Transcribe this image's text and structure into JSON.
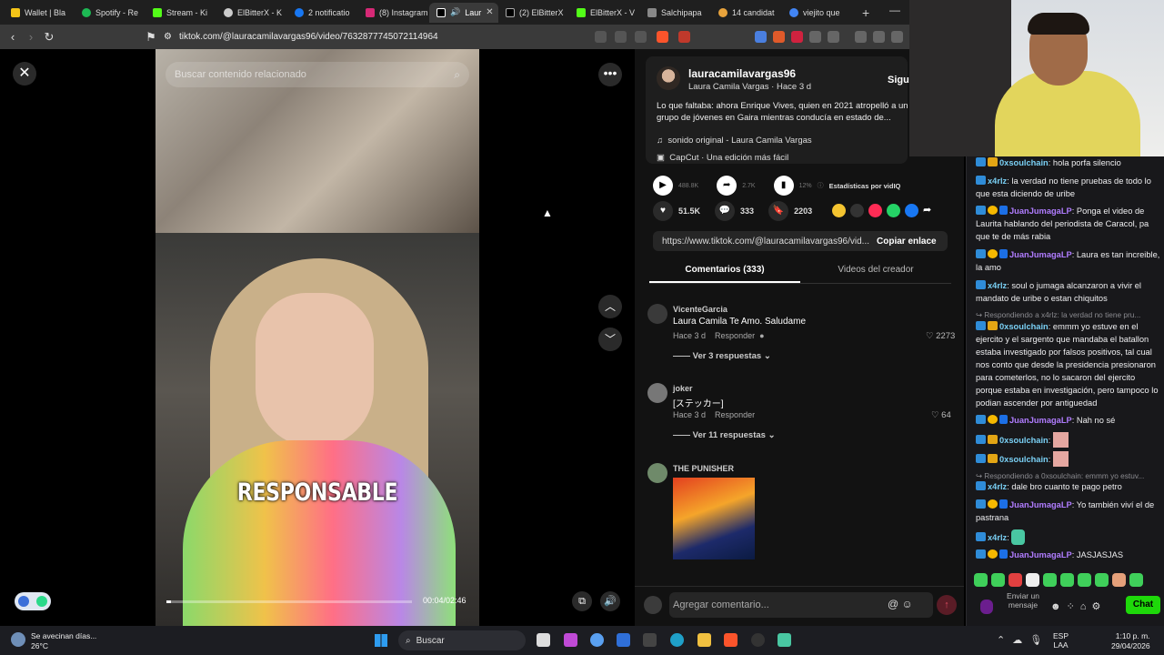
{
  "browser": {
    "tabs": [
      {
        "label": "Wallet | Bla",
        "color": "#f5c518"
      },
      {
        "label": "Spotify - Re",
        "color": "#1db954"
      },
      {
        "label": "Stream - Ki",
        "color": "#53fc18"
      },
      {
        "label": "ElBitterX - K",
        "color": "#cccccc"
      },
      {
        "label": "2 notificatio",
        "color": "#1877f2"
      },
      {
        "label": "(8) Instagram",
        "color": "#d62976"
      },
      {
        "label": "Laur",
        "color": "#ffffff",
        "active": true
      },
      {
        "label": "(2) ElBitterX",
        "color": "#000000"
      },
      {
        "label": "ElBitterX - V",
        "color": "#53fc18"
      },
      {
        "label": "Salchipapa",
        "color": "#888888"
      },
      {
        "label": "14 candidat",
        "color": "#e8a33c"
      },
      {
        "label": "viejito que",
        "color": "#4285f4"
      }
    ],
    "new_tab": "+",
    "minimize": "—",
    "url": "tiktok.com/@lauracamilavargas96/video/7632877745072114964"
  },
  "video": {
    "search_placeholder": "Buscar contenido relacionado",
    "caption": "RESPONSABLE",
    "time": "00:04/02:46",
    "progress_fraction": 0.02
  },
  "post": {
    "username": "lauracamilavargas96",
    "display_name": "Laura Camila Vargas",
    "age": "Hace 3 d",
    "follow": "Sigui",
    "description": "Lo que faltaba: ahora Enrique Vives, quien en 2021 atropelló a un grupo de jóvenes en Gaira mientras conducía en estado de...",
    "sound": "sonido original - Laura Camila Vargas",
    "capcut": "CapCut · Una edición más fácil",
    "views": "488.8K",
    "shares_stat": "2.7K",
    "percent": "12%",
    "stats_label": "Estadísticas por vidIQ",
    "likes": "51.5K",
    "comments": "333",
    "saves": "2203",
    "link": "https://www.tiktok.com/@lauracamilavargas96/vid...",
    "copy_link": "Copiar enlace",
    "tab_comments": "Comentarios (333)",
    "tab_videos": "Videos del creador"
  },
  "comments": [
    {
      "user": "VicenteGarcia",
      "text": "Laura Camila Te Amo. Saludame",
      "age": "Hace 3 d",
      "reply": "Responder",
      "likes": "2273",
      "replies": "Ver 3 respuestas"
    },
    {
      "user": "joker",
      "text": "[ステッカー]",
      "age": "Hace 3 d",
      "reply": "Responder",
      "likes": "64",
      "replies": "Ver 11 respuestas"
    },
    {
      "user": "THE PUNISHER"
    }
  ],
  "add_comment_placeholder": "Agregar comentario...",
  "chat": {
    "messages": [
      {
        "user": "0xsoulchain",
        "text": "hola porfa silencio"
      },
      {
        "user": "x4rlz",
        "text": "la verdad no tiene pruebas de todo lo que esta diciendo de uribe"
      },
      {
        "user": "JuanJumagaLP",
        "text": "Ponga el video de Laurita hablando del periodista de Caracol, pa que te de más rabia"
      },
      {
        "user": "JuanJumagaLP",
        "text": "Laura es tan increible, la amo"
      },
      {
        "user": "x4rlz",
        "text": "soul o jumaga alcanzaron a vivir el mandato de uribe o estan chiquitos"
      },
      {
        "reply_note": "Respondiendo a x4rlz: la verdad no tiene pru..."
      },
      {
        "user": "0xsoulchain",
        "text": "emmm yo estuve en el ejercito y el sargento que mandaba el batallon estaba investigado por falsos positivos, tal cual nos conto que desde la presidencia presionaron para cometerlos, no lo sacaron del ejercito porque estaba en investigación, pero tampoco lo podian ascender por antiguedad"
      },
      {
        "user": "JuanJumagaLP",
        "text": "Nah no sé"
      },
      {
        "user": "0xsoulchain",
        "text": ""
      },
      {
        "user": "0xsoulchain",
        "text": ""
      },
      {
        "reply_note": "Respondiendo a 0xsoulchain: emmm yo estuv..."
      },
      {
        "user": "x4rlz",
        "text": "dale bro cuanto te pago petro"
      },
      {
        "user": "JuanJumagaLP",
        "text": "Yo también viví el de pastrana"
      },
      {
        "user": "x4rlz",
        "text": ""
      },
      {
        "user": "JuanJumagaLP",
        "text": "JASJASJAS"
      }
    ],
    "send_label": "Enviar un mensaje",
    "chat_button": "Chat"
  },
  "taskbar": {
    "weather_line1": "Se avecinan días...",
    "weather_line2": "26°C",
    "search": "Buscar",
    "lang1": "ESP",
    "lang2": "LAA",
    "time": "1:10 p. m.",
    "date": "29/04/2026"
  }
}
